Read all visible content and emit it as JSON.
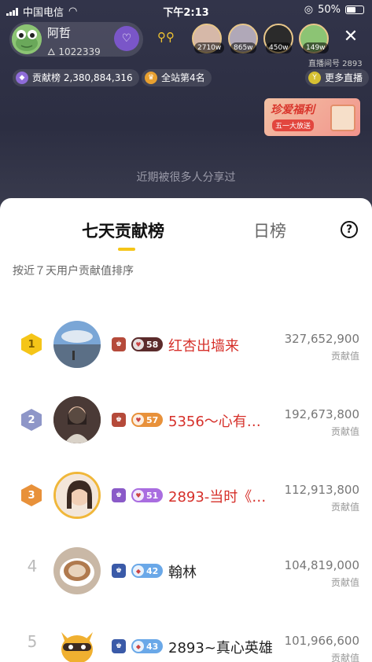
{
  "status_bar": {
    "carrier": "中国电信",
    "time": "下午2:13",
    "battery": "50%"
  },
  "live_room": {
    "host_name": "阿哲",
    "host_fans": "1022339",
    "viewers": [
      {
        "count": "2710w"
      },
      {
        "count": "865w"
      },
      {
        "count": "450w"
      },
      {
        "count": "149w"
      }
    ],
    "room_id_label": "直播间号 2893",
    "contribution_label": "贡献榜 2,380,884,316",
    "site_rank_label": "全站第4名",
    "more_live_label": "更多直播",
    "banner_title": "珍爱福利",
    "banner_sub": "五一大放送",
    "share_hint": "近期被很多人分享过"
  },
  "sheet": {
    "tab_week": "七天贡献榜",
    "tab_day": "日榜",
    "help": "?",
    "subtitle": "按近７天用户贡献值排序",
    "value_label": "贡献值",
    "rows": [
      {
        "rank": "1",
        "level": "58",
        "name": "红杏出墙来",
        "value": "327,652,900"
      },
      {
        "rank": "2",
        "level": "57",
        "name": "5356～心有…",
        "value": "192,673,800"
      },
      {
        "rank": "3",
        "level": "51",
        "name": "2893-当时《…",
        "value": "112,913,800"
      },
      {
        "rank": "4",
        "level": "42",
        "name": "翰林",
        "value": "104,819,000"
      },
      {
        "rank": "5",
        "level": "43",
        "name": "2893~真心英雄",
        "value": "101,966,600"
      }
    ]
  },
  "colors": {
    "accent": "#f5c518",
    "name_red": "#d6302a",
    "level_red": "#e05a3e",
    "level_purple": "#a96de0",
    "level_blue": "#6aa8e8"
  }
}
